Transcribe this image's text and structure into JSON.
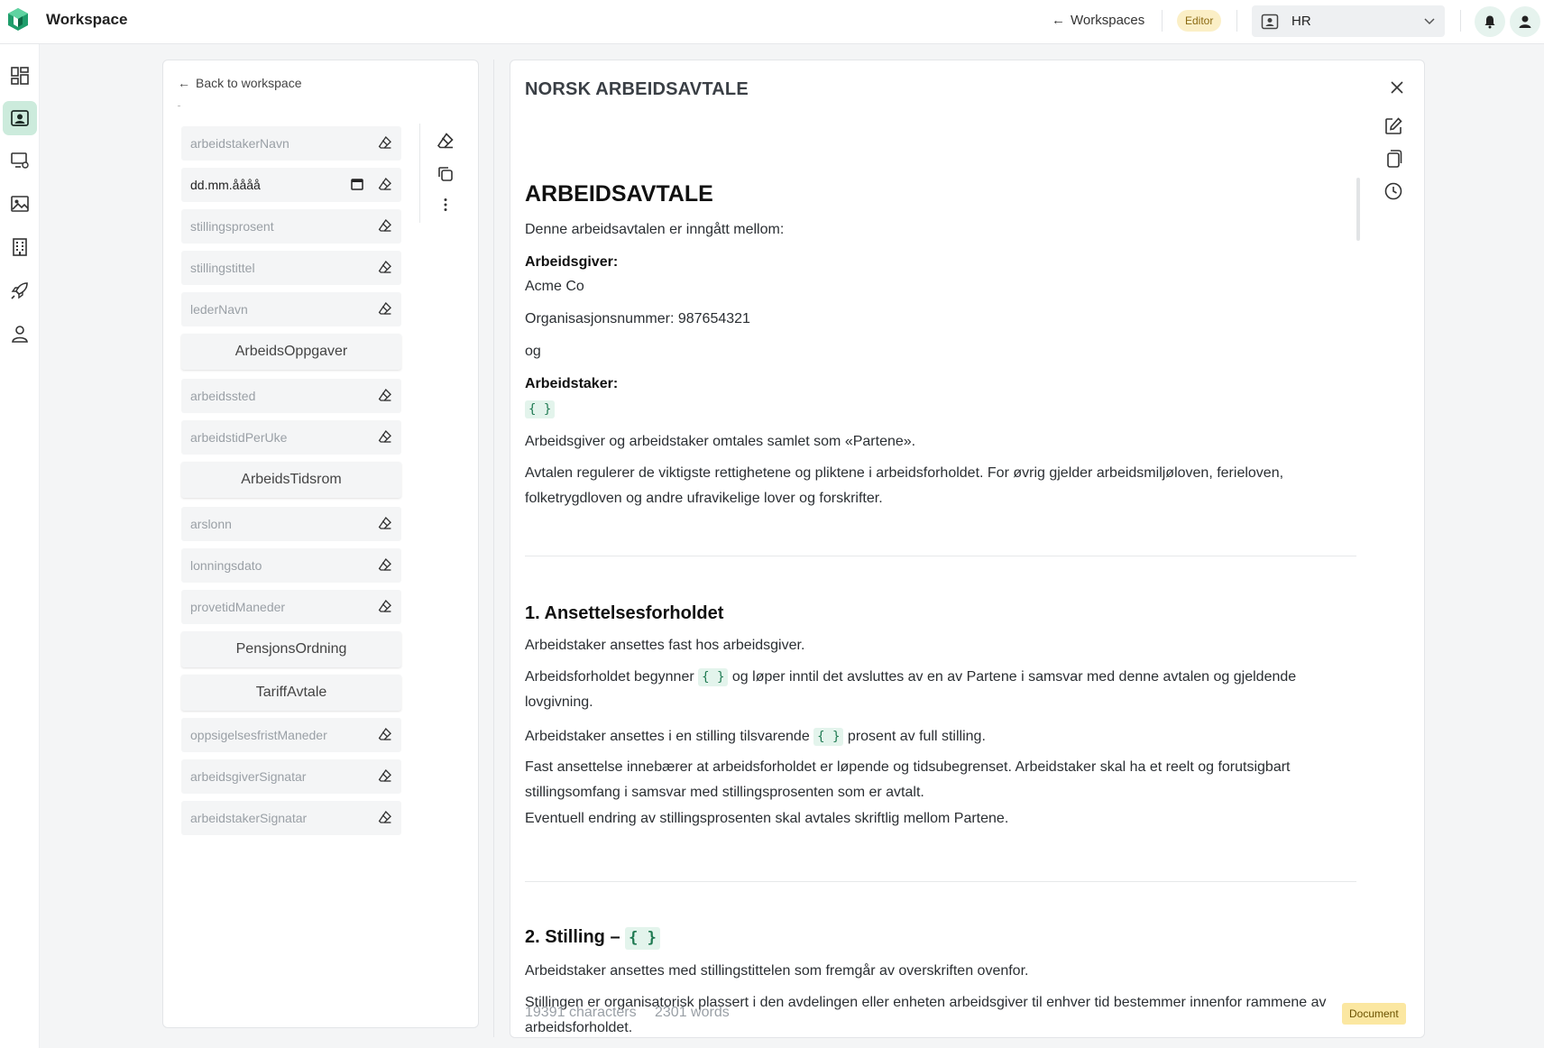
{
  "app": {
    "title": "Workspace"
  },
  "header": {
    "workspaces_link": "Workspaces",
    "role_badge": "Editor",
    "workspace_select": "HR"
  },
  "rail": {
    "items": [
      "dashboard-icon",
      "workspace-icon",
      "devices-settings-icon",
      "image-icon",
      "building-icon",
      "rocket-icon",
      "user-icon"
    ],
    "active_index": 1
  },
  "left_panel": {
    "back_label": "Back to workspace",
    "fields": [
      {
        "type": "field",
        "label": "arbeidstakerNavn"
      },
      {
        "type": "date",
        "label": "dd.mm.åååå"
      },
      {
        "type": "field",
        "label": "stillingsprosent"
      },
      {
        "type": "field",
        "label": "stillingstittel"
      },
      {
        "type": "field",
        "label": "lederNavn"
      },
      {
        "type": "group",
        "label": "ArbeidsOppgaver"
      },
      {
        "type": "field",
        "label": "arbeidssted"
      },
      {
        "type": "field",
        "label": "arbeidstidPerUke"
      },
      {
        "type": "group",
        "label": "ArbeidsTidsrom"
      },
      {
        "type": "field",
        "label": "arslonn"
      },
      {
        "type": "field",
        "label": "lonningsdato"
      },
      {
        "type": "field",
        "label": "provetidManeder"
      },
      {
        "type": "group",
        "label": "PensjonsOrdning"
      },
      {
        "type": "group",
        "label": "TariffAvtale"
      },
      {
        "type": "field",
        "label": "oppsigelsesfristManeder"
      },
      {
        "type": "field",
        "label": "arbeidsgiverSignatar"
      },
      {
        "type": "field",
        "label": "arbeidstakerSignatar"
      }
    ]
  },
  "document": {
    "heading": "NORSK ARBEIDSAVTALE",
    "title": "ARBEIDSAVTALE",
    "intro": "Denne arbeidsavtalen er inngått mellom:",
    "employer_label": "Arbeidsgiver:",
    "employer_name": "Acme Co",
    "org_number": "Organisasjonsnummer: 987654321",
    "and_word": "og",
    "employee_label": "Arbeidstaker:",
    "placeholder": "{ }",
    "parties_text": "Arbeidsgiver og arbeidstaker omtales samlet som «Partene».",
    "scope_text": "Avtalen regulerer de viktigste rettighetene og pliktene i arbeidsforholdet. For øvrig gjelder arbeidsmiljøloven, ferieloven, folketrygdloven og andre ufravikelige lover og forskrifter.",
    "s1_title": "1. Ansettelsesforholdet",
    "s1_p1": "Arbeidstaker ansettes fast hos arbeidsgiver.",
    "s1_p2_a": "Arbeidsforholdet begynner",
    "s1_p2_b": "og løper inntil det avsluttes av en av Partene i samsvar med denne avtalen og gjeldende lovgivning.",
    "s1_p3_a": "Arbeidstaker ansettes i en stilling tilsvarende",
    "s1_p3_b": "prosent av full stilling.",
    "s1_p4": "Fast ansettelse innebærer at arbeidsforholdet er løpende og tidsubegrenset. Arbeidstaker skal ha et reelt og forutsigbart stillingsomfang i samsvar med stillingsprosenten som er avtalt.",
    "s1_p5": "Eventuell endring av stillingsprosenten skal avtales skriftlig mellom Partene.",
    "s2_title": "2. Stilling –",
    "s2_p1": "Arbeidstaker ansettes med stillingstittelen som fremgår av overskriften ovenfor.",
    "s2_p2": "Stillingen er organisatorisk plassert i den avdelingen eller enheten arbeidsgiver til enhver tid bestemmer innenfor rammene av arbeidsforholdet."
  },
  "footer": {
    "characters": "19391 characters",
    "words": "2301 words",
    "badge": "Document"
  },
  "colors": {
    "accent": "#1f9d6b",
    "active_bg": "#ccebdc",
    "badge_yellow": "#fbe7a1"
  }
}
